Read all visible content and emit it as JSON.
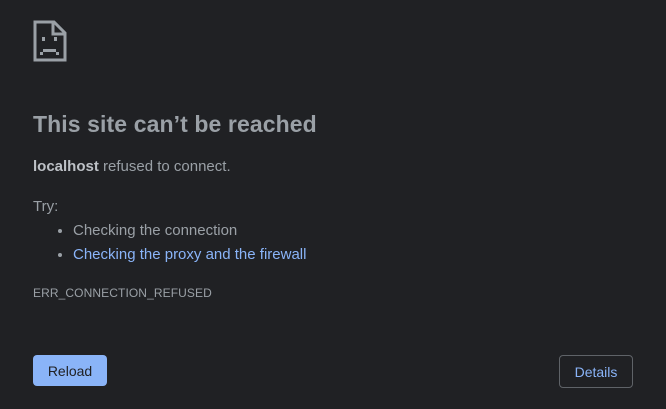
{
  "icon": "sad-page-icon",
  "colors": {
    "background": "#202124",
    "text": "#9aa0a6",
    "accent": "#8ab4f8"
  },
  "error": {
    "title": "This site can’t be reached",
    "host": "localhost",
    "summary_suffix": " refused to connect.",
    "try_label": "Try:",
    "suggestions": [
      "Checking the connection",
      "Checking the proxy and the firewall"
    ],
    "code": "ERR_CONNECTION_REFUSED"
  },
  "buttons": {
    "reload_label": "Reload",
    "details_label": "Details"
  }
}
